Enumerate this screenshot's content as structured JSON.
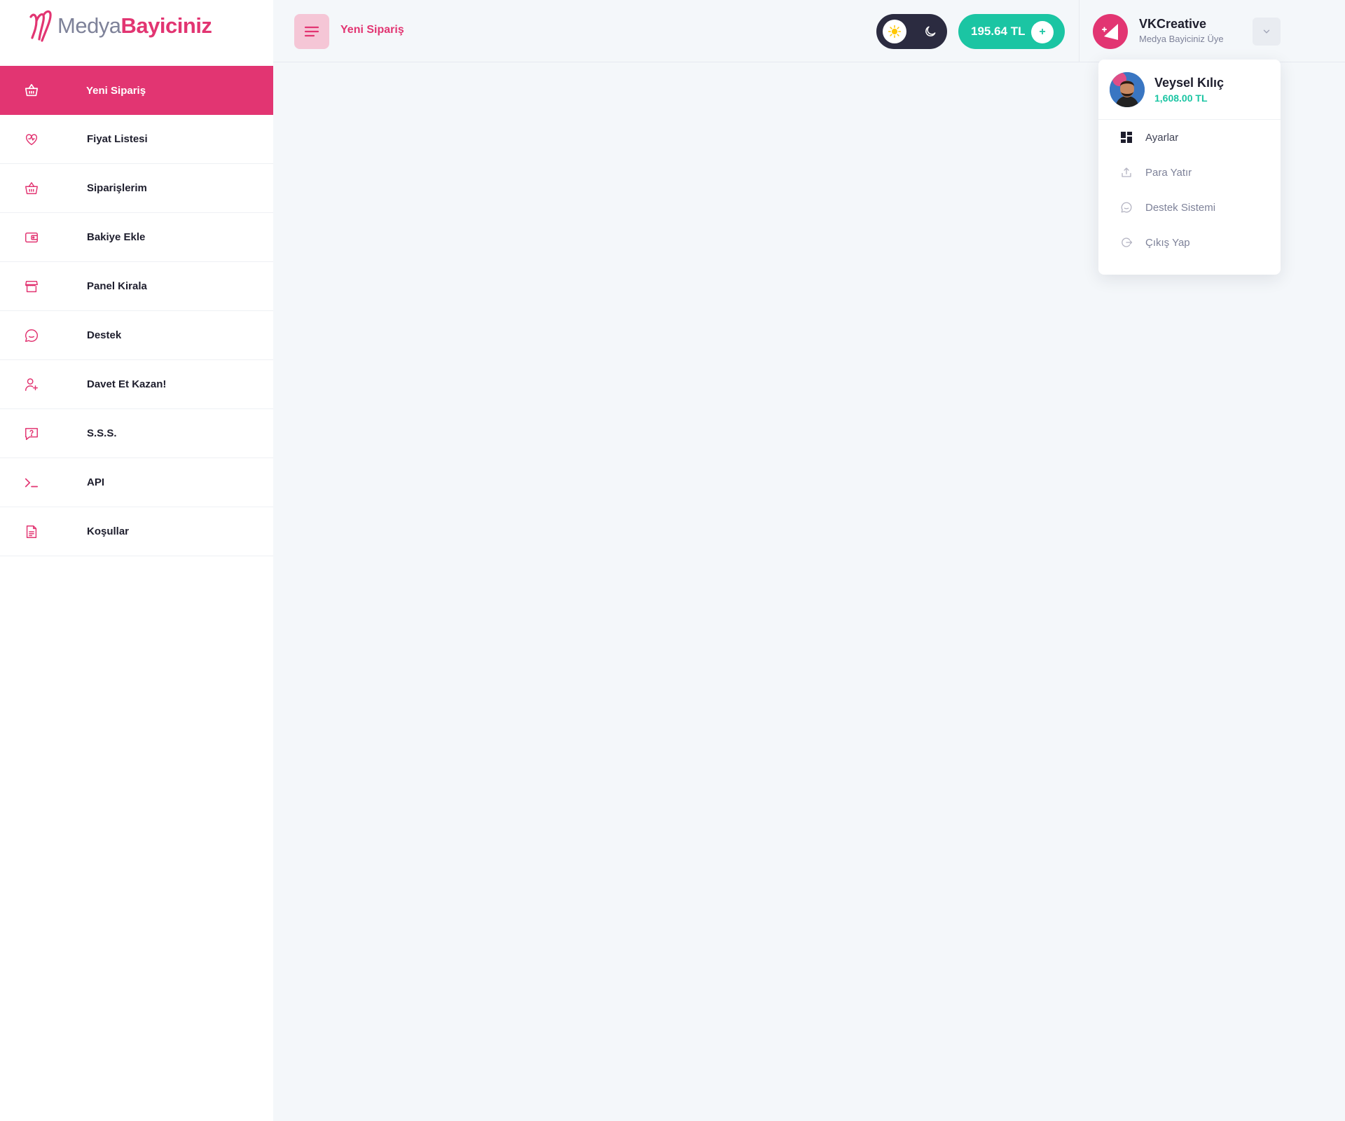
{
  "brand": {
    "part1": "Medya",
    "part2": "Bayiciniz",
    "accent": "#e23572"
  },
  "sidebar": {
    "items": [
      {
        "label": "Yeni Sipariş",
        "icon": "basket-icon",
        "active": true
      },
      {
        "label": "Fiyat Listesi",
        "icon": "heart-icon"
      },
      {
        "label": "Siparişlerim",
        "icon": "basket-icon"
      },
      {
        "label": "Bakiye Ekle",
        "icon": "wallet-icon"
      },
      {
        "label": "Panel Kirala",
        "icon": "store-icon"
      },
      {
        "label": "Destek",
        "icon": "chat-icon"
      },
      {
        "label": "Davet Et Kazan!",
        "icon": "user-add-icon"
      },
      {
        "label": "S.S.S.",
        "icon": "question-icon"
      },
      {
        "label": "API",
        "icon": "terminal-icon"
      },
      {
        "label": "Koşullar",
        "icon": "document-icon"
      }
    ]
  },
  "header": {
    "page_title": "Yeni Sipariş",
    "balance": "195.64 TL",
    "add_symbol": "+",
    "user": {
      "name": "VKCreative",
      "role": "Medya Bayiciniz Üye"
    }
  },
  "dropdown": {
    "name": "Veysel Kılıç",
    "balance": "1,608.00 TL",
    "items": [
      {
        "label": "Ayarlar",
        "icon": "dashboard-icon"
      },
      {
        "label": "Para Yatır",
        "icon": "upload-icon"
      },
      {
        "label": "Destek Sistemi",
        "icon": "chat-icon"
      },
      {
        "label": "Çıkış Yap",
        "icon": "logout-icon"
      }
    ]
  },
  "colors": {
    "accent": "#e23572",
    "success": "#1bc5a3",
    "dark": "#2b2b40",
    "background": "#f4f7fa"
  }
}
